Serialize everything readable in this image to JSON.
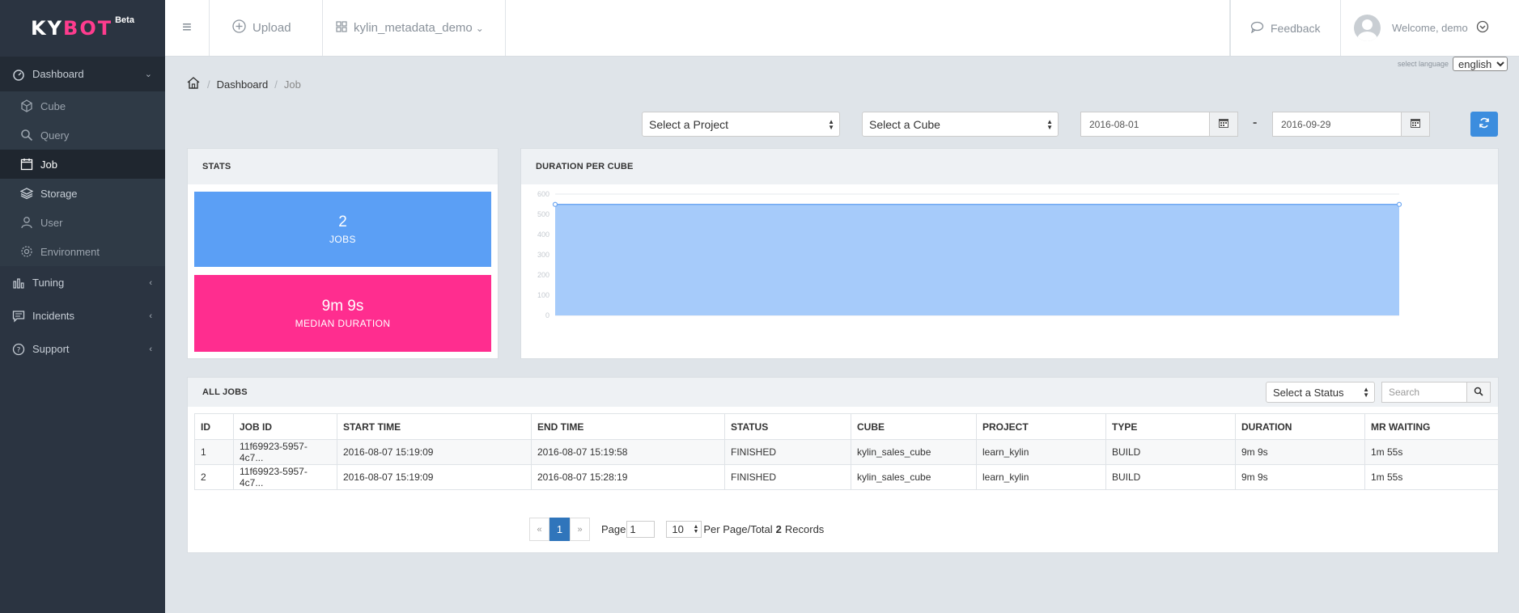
{
  "brand": {
    "kybot_ky": "KY",
    "kybot_bot": "BOT",
    "beta": "Beta"
  },
  "sidebar": {
    "dashboard": "Dashboard",
    "sub_items": [
      {
        "label": "Cube",
        "icon": "cube-icon"
      },
      {
        "label": "Query",
        "icon": "search-icon"
      },
      {
        "label": "Job",
        "icon": "calendar-icon",
        "active": true
      },
      {
        "label": "Storage",
        "icon": "layers-icon"
      },
      {
        "label": "User",
        "icon": "user-icon"
      },
      {
        "label": "Environment",
        "icon": "gear-icon"
      }
    ],
    "tuning": "Tuning",
    "incidents": "Incidents",
    "support": "Support"
  },
  "topbar": {
    "upload": "Upload",
    "project": "kylin_metadata_demo",
    "feedback": "Feedback",
    "welcome": "Welcome, demo"
  },
  "language": {
    "label": "select language",
    "value": "english"
  },
  "breadcrumb": {
    "dashboard": "Dashboard",
    "current": "Job"
  },
  "filters": {
    "project": "Select a Project",
    "cube": "Select a Cube",
    "date_from": "2016-08-01",
    "date_sep": "-",
    "date_to": "2016-09-29"
  },
  "stats": {
    "title": "STATS",
    "jobs_value": "2",
    "jobs_label": "JOBS",
    "median_value": "9m 9s",
    "median_label": "MEDIAN DURATION",
    "jobs_color": "#5b9ff5",
    "median_color": "#ff2d8f"
  },
  "chart_panel": {
    "title": "DURATION PER CUBE"
  },
  "chart_data": {
    "type": "area",
    "title": "DURATION PER CUBE",
    "x": [
      0,
      1
    ],
    "series": [
      {
        "values": [
          549,
          549
        ]
      }
    ],
    "ylim": [
      0,
      600
    ],
    "yticks": [
      "0",
      "100",
      "200",
      "300",
      "400",
      "500",
      "600"
    ],
    "grid": true,
    "fill_color": "#a6cbfa",
    "line_color": "#6fa8f2"
  },
  "jobs": {
    "title": "ALL JOBS",
    "status_select": "Select a Status",
    "search_placeholder": "Search",
    "columns": [
      "ID",
      "JOB ID",
      "START TIME",
      "END TIME",
      "STATUS",
      "CUBE",
      "PROJECT",
      "TYPE",
      "DURATION",
      "MR WAITING"
    ],
    "rows": [
      [
        "1",
        "11f69923-5957-4c7...",
        "2016-08-07 15:19:09",
        "2016-08-07 15:19:58",
        "FINISHED",
        "kylin_sales_cube",
        "learn_kylin",
        "BUILD",
        "9m 9s",
        "1m 55s"
      ],
      [
        "2",
        "11f69923-5957-4c7...",
        "2016-08-07 15:19:09",
        "2016-08-07 15:28:19",
        "FINISHED",
        "kylin_sales_cube",
        "learn_kylin",
        "BUILD",
        "9m 9s",
        "1m 55s"
      ]
    ]
  },
  "pagination": {
    "prev": "«",
    "current": "1",
    "next": "»",
    "page_label": "Page",
    "page_value": "1",
    "per_page": "10",
    "per_page_text": "Per Page/Total",
    "total": "2",
    "records": "Records"
  }
}
